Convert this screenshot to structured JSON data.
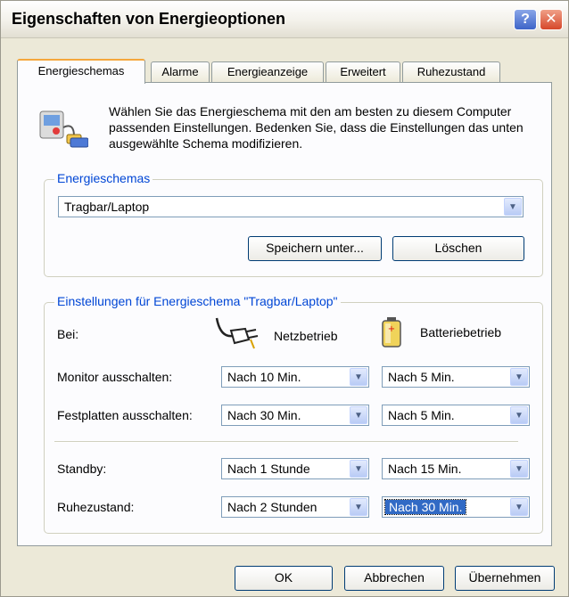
{
  "window": {
    "title": "Eigenschaften von Energieoptionen",
    "help_glyph": "?",
    "close_glyph": "✕"
  },
  "tabs": [
    {
      "label": "Energieschemas",
      "active": true
    },
    {
      "label": "Alarme",
      "active": false
    },
    {
      "label": "Energieanzeige",
      "active": false
    },
    {
      "label": "Erweitert",
      "active": false
    },
    {
      "label": "Ruhezustand",
      "active": false
    }
  ],
  "intro": {
    "text": "Wählen Sie das Energieschema mit den am besten zu diesem Computer passenden Einstellungen. Bedenken Sie, dass die Einstellungen das unten ausgewählte Schema modifizieren."
  },
  "schemes": {
    "legend": "Energieschemas",
    "selected": "Tragbar/Laptop",
    "save_as_label": "Speichern unter...",
    "delete_label": "Löschen"
  },
  "settings": {
    "legend": "Einstellungen für Energieschema \"Tragbar/Laptop\"",
    "bei_label": "Bei:",
    "ac_label": "Netzbetrieb",
    "battery_label": "Batteriebetrieb",
    "rows": [
      {
        "label": "Monitor ausschalten:",
        "ac": "Nach 10 Min.",
        "battery": "Nach 5 Min."
      },
      {
        "label": "Festplatten ausschalten:",
        "ac": "Nach 30 Min.",
        "battery": "Nach 5 Min."
      },
      {
        "label": "Standby:",
        "ac": "Nach 1 Stunde",
        "battery": "Nach 15 Min."
      },
      {
        "label": "Ruhezustand:",
        "ac": "Nach 2 Stunden",
        "battery": "Nach 30 Min."
      }
    ]
  },
  "footer": {
    "ok_label": "OK",
    "cancel_label": "Abbrechen",
    "apply_label": "Übernehmen"
  },
  "colors": {
    "window_bg": "#ECE9D8",
    "legend_text": "#0046D5",
    "focus_tab": "#F5A73C"
  }
}
